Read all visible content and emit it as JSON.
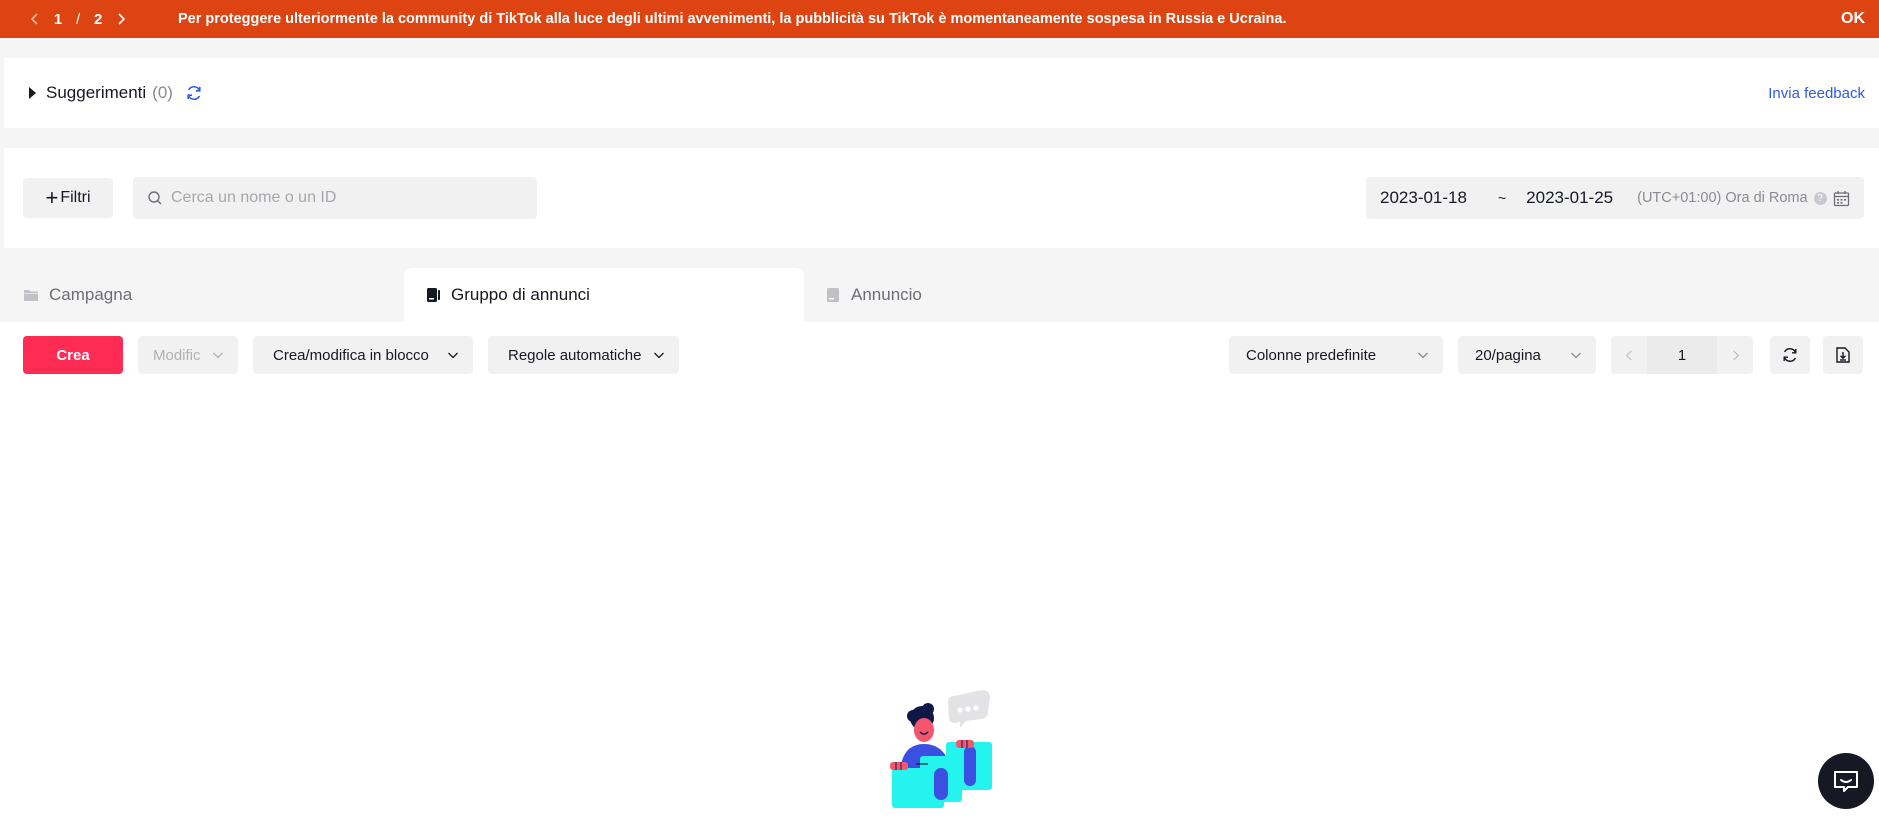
{
  "banner": {
    "page_current": "1",
    "page_separator": "/",
    "page_total": "2",
    "message": "Per proteggere ulteriormente la community di TikTok alla luce degli ultimi avvenimenti, la pubblicità su TikTok è momentaneamente sospesa in Russia e Ucraina.",
    "ok_label": "OK",
    "color": "#dd4412"
  },
  "suggestions": {
    "title": "Suggerimenti",
    "count": "(0)",
    "feedback_label": "Invia feedback"
  },
  "filters": {
    "filter_label": "Filtri",
    "search_placeholder": "Cerca un nome o un ID",
    "date_start": "2023-01-18",
    "date_separator": "~",
    "date_end": "2023-01-25",
    "timezone": "(UTC+01:00) Ora di Roma",
    "help_icon": "?"
  },
  "tabs": [
    {
      "label": "Campagna",
      "icon": "folder-icon",
      "active": false
    },
    {
      "label": "Gruppo di annunci",
      "icon": "ad-group-icon",
      "active": true
    },
    {
      "label": "Annuncio",
      "icon": "ad-icon",
      "active": false
    }
  ],
  "toolbar": {
    "create_label": "Crea",
    "edit_label": "Modific",
    "bulk_label": "Crea/modifica in blocco",
    "rules_label": "Regole automatiche",
    "columns_label": "Colonne predefinite",
    "page_size_label": "20/pagina",
    "page_number": "1"
  },
  "colors": {
    "accent": "#fe2c55",
    "link": "#2e5ae8",
    "panel": "#f1f1f2"
  }
}
